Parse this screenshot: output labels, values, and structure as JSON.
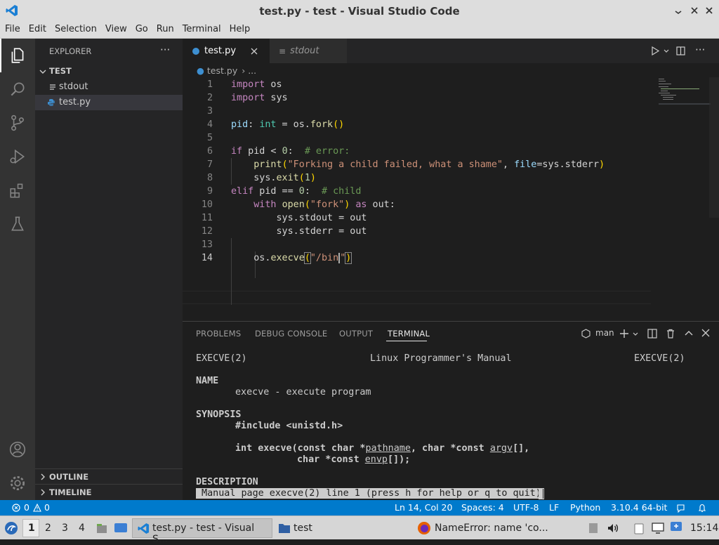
{
  "window": {
    "title": "test.py - test - Visual Studio Code"
  },
  "menu": [
    "File",
    "Edit",
    "Selection",
    "View",
    "Go",
    "Run",
    "Terminal",
    "Help"
  ],
  "sidebar": {
    "header": "EXPLORER",
    "folder": "TEST",
    "files": [
      "stdout",
      "test.py"
    ],
    "outline": "OUTLINE",
    "timeline": "TIMELINE"
  },
  "tabs": [
    {
      "label": "test.py"
    },
    {
      "label": "stdout"
    }
  ],
  "breadcrumb": {
    "file": "test.py",
    "rest": "..."
  },
  "code": {
    "line_numbers": [
      "1",
      "2",
      "3",
      "4",
      "5",
      "6",
      "7",
      "8",
      "9",
      "10",
      "11",
      "12",
      "13",
      "14"
    ]
  },
  "panel": {
    "tabs": [
      "PROBLEMS",
      "DEBUG CONSOLE",
      "OUTPUT",
      "TERMINAL"
    ],
    "terminal_name": "man"
  },
  "terminal": {
    "header_left": "EXECVE(2)",
    "header_mid": "Linux Programmer's Manual",
    "header_right": "EXECVE(2)",
    "name_h": "NAME",
    "name_desc": "execve - execute program",
    "syn_h": "SYNOPSIS",
    "include": "#include <unistd.h>",
    "desc_h": "DESCRIPTION",
    "status_line": " Manual page execve(2) line 1 (press h for help or q to quit)"
  },
  "status": {
    "problems": "0",
    "warnings": "0",
    "position": "Ln 14, Col 20",
    "spaces": "Spaces: 4",
    "encoding": "UTF-8",
    "eol": "LF",
    "language": "Python",
    "interpreter": "3.10.4 64-bit"
  },
  "taskbar": {
    "workspaces": [
      "1",
      "2",
      "3",
      "4"
    ],
    "vscode": "test.py - test - Visual S...",
    "folder": "test",
    "firefox": "NameError: name 'co...",
    "clock": "15:14"
  }
}
